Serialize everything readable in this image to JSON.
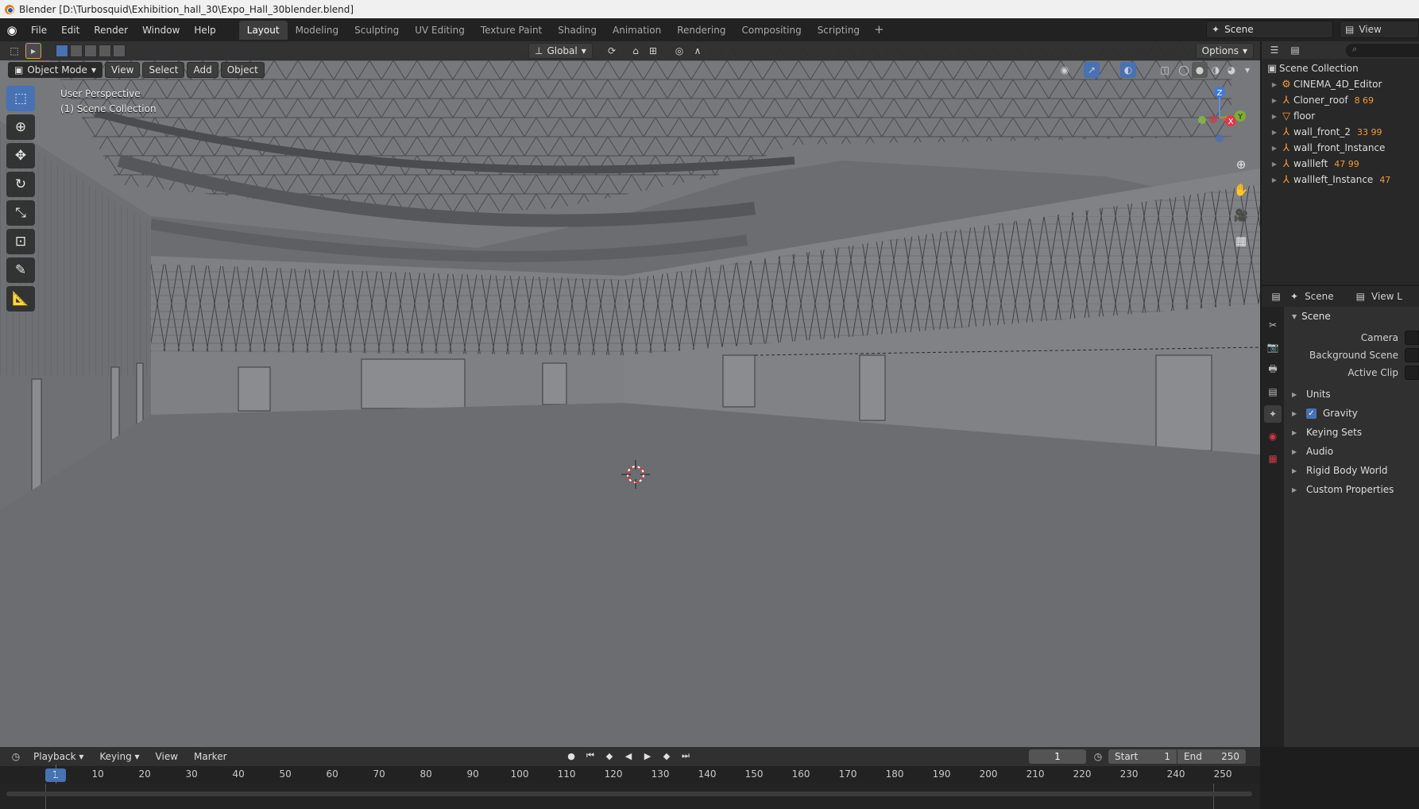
{
  "window": {
    "title": "Blender [D:\\Turbosquid\\Exhibition_hall_30\\Expo_Hall_30blender.blend]"
  },
  "menu": [
    "File",
    "Edit",
    "Render",
    "Window",
    "Help"
  ],
  "workspaces": [
    "Layout",
    "Modeling",
    "Sculpting",
    "UV Editing",
    "Texture Paint",
    "Shading",
    "Animation",
    "Rendering",
    "Compositing",
    "Scripting"
  ],
  "active_workspace": "Layout",
  "scene_picker": "Scene",
  "view_layer_picker": "View",
  "viewport": {
    "orientation": "Global",
    "options_label": "Options",
    "mode": "Object Mode",
    "header_menus": [
      "View",
      "Select",
      "Add",
      "Object"
    ],
    "overlay_line1": "User Perspective",
    "overlay_line2": "(1) Scene Collection",
    "gizmo_x": "X",
    "gizmo_y": "Y",
    "gizmo_z": "Z"
  },
  "outliner": {
    "root": "Scene Collection",
    "items": [
      {
        "name": "CINEMA_4D_Editor",
        "extra": ""
      },
      {
        "name": "Cloner_roof",
        "extra": "8 69"
      },
      {
        "name": "floor",
        "extra": ""
      },
      {
        "name": "wall_front_2",
        "extra": "33 99"
      },
      {
        "name": "wall_front_Instance",
        "extra": ""
      },
      {
        "name": "wallleft",
        "extra": "47 99"
      },
      {
        "name": "wallleft_Instance",
        "extra": "47"
      }
    ]
  },
  "properties": {
    "context": "Scene",
    "view_layer": "View L",
    "panel": "Scene",
    "fields": [
      "Camera",
      "Background Scene",
      "Active Clip"
    ],
    "subpanels": [
      "Units",
      "Gravity",
      "Keying Sets",
      "Audio",
      "Rigid Body World",
      "Custom Properties"
    ],
    "gravity_checked": true
  },
  "timeline": {
    "menus": [
      "Playback",
      "Keying",
      "View",
      "Marker"
    ],
    "current_frame": "1",
    "start_label": "Start",
    "start_value": "1",
    "end_label": "End",
    "end_value": "250",
    "ticks": [
      "10",
      "20",
      "30",
      "40",
      "50",
      "60",
      "70",
      "80",
      "90",
      "100",
      "110",
      "120",
      "130",
      "140",
      "150",
      "160",
      "170",
      "180",
      "190",
      "200",
      "210",
      "220",
      "230",
      "240",
      "250"
    ],
    "cursor_label": "1"
  }
}
